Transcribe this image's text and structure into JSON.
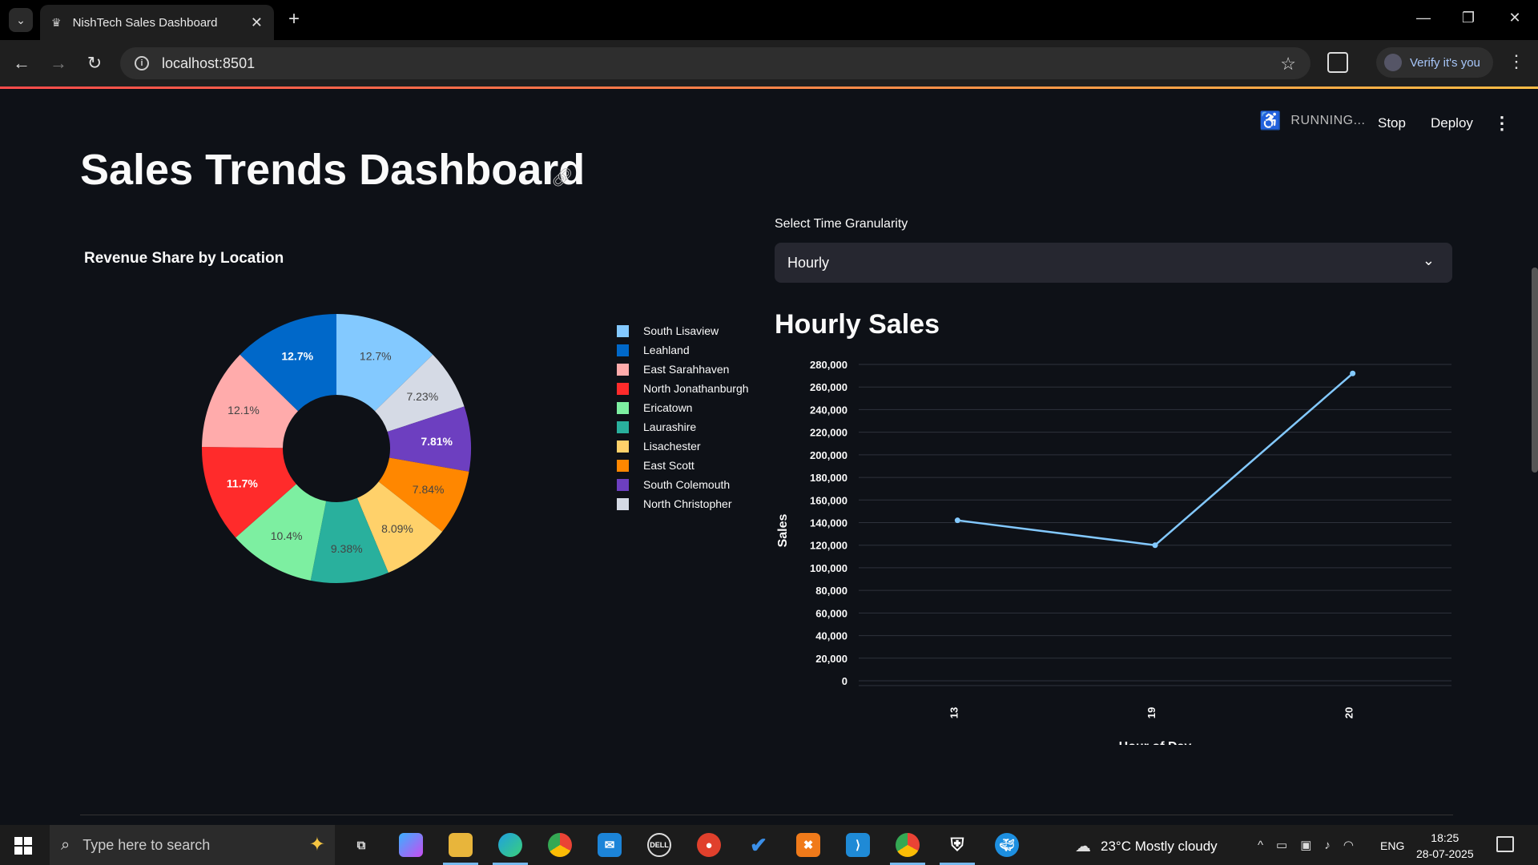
{
  "browser": {
    "tab_title": "NishTech Sales Dashboard",
    "url": "localhost:8501",
    "profile_label": "Verify it's you"
  },
  "app_header": {
    "status": "RUNNING...",
    "stop_label": "Stop",
    "deploy_label": "Deploy"
  },
  "page": {
    "title": "Sales Trends Dashboard"
  },
  "pie": {
    "title": "Revenue Share by Location"
  },
  "controls": {
    "granularity_label": "Select Time Granularity",
    "granularity_value": "Hourly"
  },
  "line": {
    "title": "Hourly Sales"
  },
  "chart_data": [
    {
      "type": "pie",
      "title": "Revenue Share by Location",
      "hole": true,
      "slices": [
        {
          "label": "South Lisaview",
          "value": 12.7,
          "text": "12.7%",
          "color": "#83c9ff"
        },
        {
          "label": "North Christopher",
          "value": 7.23,
          "text": "7.23%",
          "color": "#d5dae5"
        },
        {
          "label": "South Colemouth",
          "value": 7.81,
          "text": "7.81%",
          "color": "#6d3fc0"
        },
        {
          "label": "East Scott",
          "value": 7.84,
          "text": "7.84%",
          "color": "#ff8700"
        },
        {
          "label": "Lisachester",
          "value": 8.09,
          "text": "8.09%",
          "color": "#ffd16a"
        },
        {
          "label": "Laurashire",
          "value": 9.38,
          "text": "9.38%",
          "color": "#29b09d"
        },
        {
          "label": "Ericatown",
          "value": 10.4,
          "text": "10.4%",
          "color": "#7defa1"
        },
        {
          "label": "North Jonathanburgh",
          "value": 11.7,
          "text": "11.7%",
          "color": "#ff2b2b"
        },
        {
          "label": "East Sarahhaven",
          "value": 12.1,
          "text": "12.1%",
          "color": "#ffabab"
        },
        {
          "label": "Leahland",
          "value": 12.7,
          "text": "12.7%",
          "color": "#0068c9"
        }
      ],
      "legend": [
        {
          "label": "South Lisaview",
          "color": "#83c9ff"
        },
        {
          "label": "Leahland",
          "color": "#0068c9"
        },
        {
          "label": "East Sarahhaven",
          "color": "#ffabab"
        },
        {
          "label": "North Jonathanburgh",
          "color": "#ff2b2b"
        },
        {
          "label": "Ericatown",
          "color": "#7defa1"
        },
        {
          "label": "Laurashire",
          "color": "#29b09d"
        },
        {
          "label": "Lisachester",
          "color": "#ffd16a"
        },
        {
          "label": "East Scott",
          "color": "#ff8700"
        },
        {
          "label": "South Colemouth",
          "color": "#6d3fc0"
        },
        {
          "label": "North Christopher",
          "color": "#d5dae5"
        }
      ]
    },
    {
      "type": "line",
      "title": "Hourly Sales",
      "xlabel": "Hour of Day",
      "ylabel": "Sales",
      "categories": [
        "13",
        "19",
        "20"
      ],
      "values": [
        142000,
        120000,
        272000
      ],
      "ylim": [
        0,
        280000
      ],
      "yticks": [
        0,
        20000,
        40000,
        60000,
        80000,
        100000,
        120000,
        140000,
        160000,
        180000,
        200000,
        220000,
        240000,
        260000,
        280000
      ],
      "ytick_labels": [
        "0",
        "20,000",
        "40,000",
        "60,000",
        "80,000",
        "100,000",
        "120,000",
        "140,000",
        "160,000",
        "180,000",
        "200,000",
        "220,000",
        "240,000",
        "260,000",
        "280,000"
      ],
      "color": "#83c9ff",
      "grid": true
    }
  ],
  "taskbar": {
    "search_placeholder": "Type here to search",
    "weather": "23°C  Mostly cloudy",
    "language": "ENG",
    "time": "18:25",
    "date": "28-07-2025"
  }
}
